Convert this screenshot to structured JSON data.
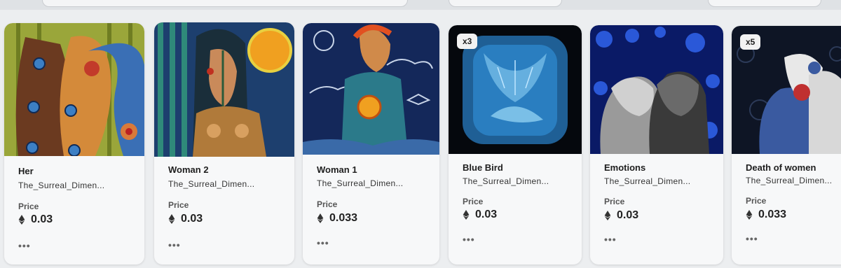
{
  "price_label": "Price",
  "more_glyph": "•••",
  "cards": [
    {
      "title": "Her",
      "creator": "The_Surreal_Dimen...",
      "price": "0.03",
      "badge": ""
    },
    {
      "title": "Woman 2",
      "creator": "The_Surreal_Dimen...",
      "price": "0.03",
      "badge": ""
    },
    {
      "title": "Woman 1",
      "creator": "The_Surreal_Dimen...",
      "price": "0.033",
      "badge": ""
    },
    {
      "title": "Blue Bird",
      "creator": "The_Surreal_Dimen...",
      "price": "0.03",
      "badge": "x3"
    },
    {
      "title": "Emotions",
      "creator": "The_Surreal_Dimen...",
      "price": "0.03",
      "badge": ""
    },
    {
      "title": "Death of women",
      "creator": "The_Surreal_Dimen...",
      "price": "0.033",
      "badge": "x5"
    }
  ],
  "icons": {
    "currency": "ethereum-icon",
    "more": "more-options-icon"
  }
}
